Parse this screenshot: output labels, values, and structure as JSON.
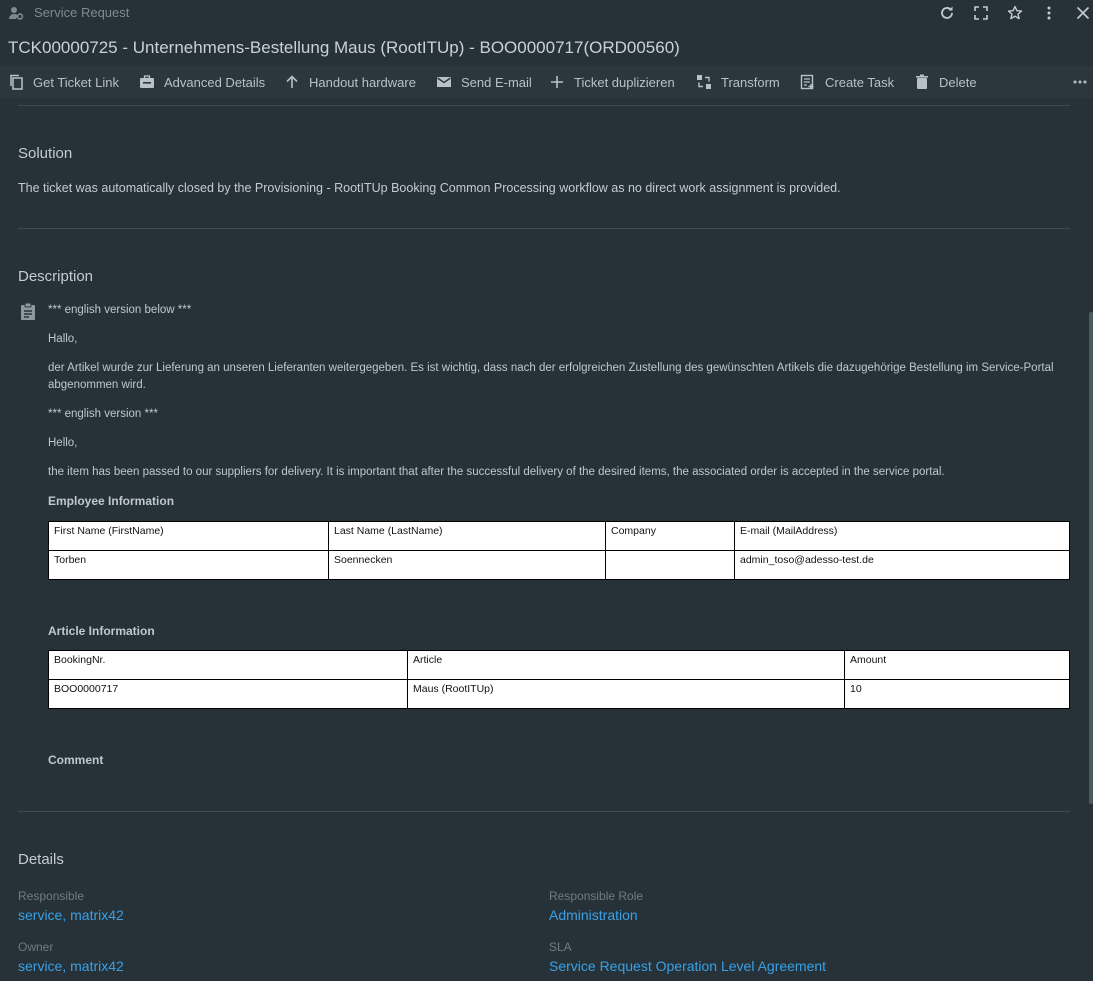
{
  "window": {
    "app_title": "Service Request",
    "icons": [
      "user-gear-icon",
      "refresh-icon",
      "maximize-icon",
      "star-icon",
      "more-vertical-icon",
      "close-icon"
    ]
  },
  "ticket": {
    "title": "TCK00000725 - Unternehmens-Bestellung Maus (RootITUp) - BOO0000717(ORD00560)"
  },
  "toolbar": {
    "get_ticket_link": "Get Ticket Link",
    "advanced_details": "Advanced Details",
    "handout_hardware": "Handout hardware",
    "send_email": "Send E-mail",
    "ticket_duplizieren": "Ticket duplizieren",
    "transform": "Transform",
    "create_task": "Create Task",
    "delete": "Delete"
  },
  "solution": {
    "title": "Solution",
    "text": "The ticket was automatically closed by the Provisioning - RootITUp Booking Common Processing workflow as no direct work assignment is provided."
  },
  "description": {
    "title": "Description",
    "line1": "*** english version below ***",
    "line2": "Hallo,",
    "line3": "der Artikel wurde zur Lieferung an unseren Lieferanten weitergegeben. Es ist wichtig, dass nach der erfolgreichen Zustellung des gewünschten Artikels die dazugehörige Bestellung im Service-Portal abgenommen wird.",
    "line4": "*** english version ***",
    "line5": "Hello,",
    "line6": "the item has been passed to our suppliers for delivery. It is important that after the successful delivery of the desired items, the associated order is accepted in the service portal.",
    "employee_heading": "Employee Information",
    "employee_table": {
      "headers": [
        "First Name (FirstName)",
        "Last Name (LastName)",
        "Company",
        "E-mail (MailAddress)"
      ],
      "row": [
        "Torben",
        "Soennecken",
        "",
        "admin_toso@adesso-test.de"
      ]
    },
    "article_heading": "Article Information",
    "article_table": {
      "headers": [
        "BookingNr.",
        "Article",
        "Amount"
      ],
      "row": [
        "BOO0000717",
        "Maus (RootITUp)",
        "10"
      ]
    },
    "comment_heading": "Comment"
  },
  "details": {
    "title": "Details",
    "responsible_label": "Responsible",
    "responsible_value": "service, matrix42",
    "responsible_role_label": "Responsible Role",
    "responsible_role_value": "Administration",
    "owner_label": "Owner",
    "owner_value": "service, matrix42",
    "sla_label": "SLA",
    "sla_value": "Service Request Operation Level Agreement"
  },
  "colors": {
    "background": "#263238",
    "toolbar": "#2b373d",
    "link": "#3aa0e6",
    "text": "#c5ccd0",
    "muted": "#6f7b81"
  }
}
